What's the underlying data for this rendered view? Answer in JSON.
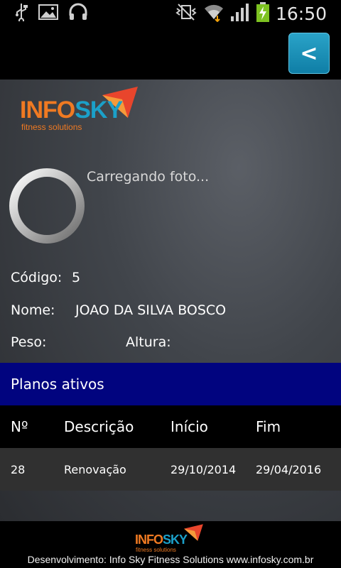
{
  "status_bar": {
    "time": "16:50",
    "icons": [
      "usb-icon",
      "image-icon",
      "headphones-icon",
      "vibrate-mute-icon",
      "wifi-icon",
      "signal-icon",
      "battery-charging-icon"
    ]
  },
  "action_bar": {
    "back_label": "<"
  },
  "logo": {
    "info": "INFO",
    "sky": "SKY",
    "subtitle": "fitness solutions"
  },
  "photo": {
    "loading_text": "Carregando foto..."
  },
  "profile": {
    "codigo_label": "Código:",
    "codigo_value": "5",
    "nome_label": "Nome:",
    "nome_value": "JOAO DA SILVA BOSCO",
    "peso_label": "Peso:",
    "peso_value": "",
    "altura_label": "Altura:",
    "altura_value": ""
  },
  "plans": {
    "title": "Planos ativos",
    "columns": [
      "Nº",
      "Descrição",
      "Início",
      "Fim"
    ],
    "rows": [
      [
        "28",
        "Renovação",
        "29/10/2014",
        "29/04/2016"
      ]
    ]
  },
  "footer": {
    "logo_info": "INFO",
    "logo_sky": "SKY",
    "logo_subtitle": "fitness solutions",
    "credits": "Desenvolvimento: Info Sky Fitness Solutions www.infosky.com.br"
  },
  "colors": {
    "plans_header": "#01047f",
    "accent_orange": "#f07a22",
    "accent_blue": "#1ba0c9",
    "back_button": "#1a8fb8"
  }
}
